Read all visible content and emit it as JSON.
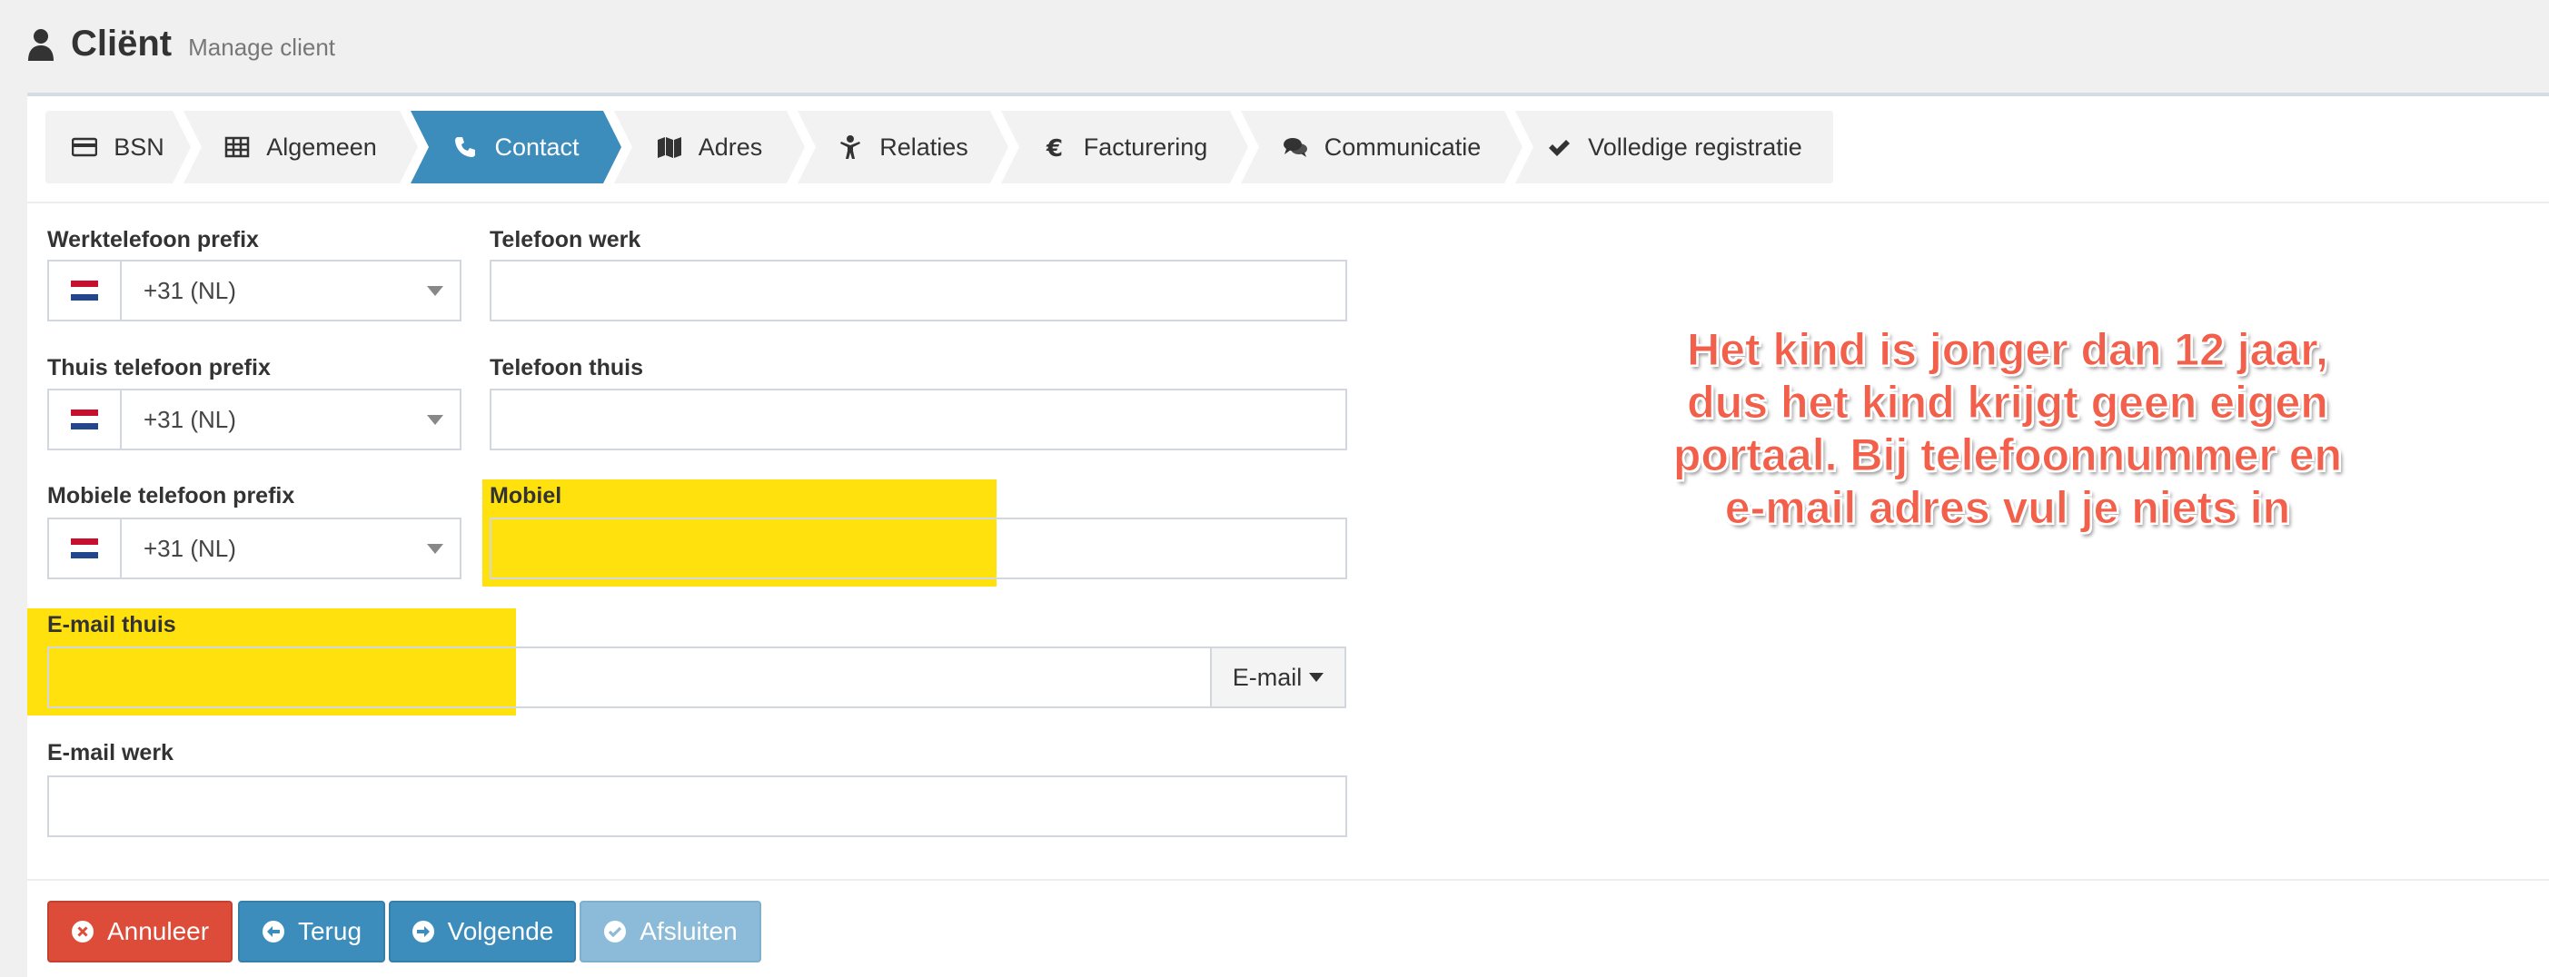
{
  "header": {
    "title": "Cliënt",
    "subtitle": "Manage client"
  },
  "wizard": {
    "steps": [
      {
        "label": "BSN",
        "icon": "credit-card-icon"
      },
      {
        "label": "Algemeen",
        "icon": "table-icon"
      },
      {
        "label": "Contact",
        "icon": "phone-icon",
        "active": true
      },
      {
        "label": "Adres",
        "icon": "map-icon"
      },
      {
        "label": "Relaties",
        "icon": "child-icon"
      },
      {
        "label": "Facturering",
        "icon": "euro-icon"
      },
      {
        "label": "Communicatie",
        "icon": "comments-icon"
      },
      {
        "label": "Volledige registratie",
        "icon": "check-icon"
      }
    ]
  },
  "form": {
    "work_prefix": {
      "label": "Werktelefoon prefix",
      "value": "+31 (NL)"
    },
    "work_phone": {
      "label": "Telefoon werk",
      "value": ""
    },
    "home_prefix": {
      "label": "Thuis telefoon prefix",
      "value": "+31 (NL)"
    },
    "home_phone": {
      "label": "Telefoon thuis",
      "value": ""
    },
    "mobile_prefix": {
      "label": "Mobiele telefoon prefix",
      "value": "+31 (NL)"
    },
    "mobile": {
      "label": "Mobiel",
      "value": ""
    },
    "email_home": {
      "label": "E-mail thuis",
      "value": "",
      "type_button": "E-mail"
    },
    "email_work": {
      "label": "E-mail werk",
      "value": ""
    }
  },
  "annotation": {
    "lines": [
      "Het kind is jonger dan 12 jaar,",
      "dus het kind krijgt geen eigen",
      "portaal. Bij telefoonnummer en",
      "e-mail adres vul je niets in"
    ],
    "color": "#f25f4a"
  },
  "buttons": {
    "cancel": "Annuleer",
    "back": "Terug",
    "next": "Volgende",
    "finish": "Afsluiten"
  },
  "colors": {
    "primary": "#3c8dbc",
    "danger": "#dd4b39",
    "highlight": "#ffdf00"
  }
}
